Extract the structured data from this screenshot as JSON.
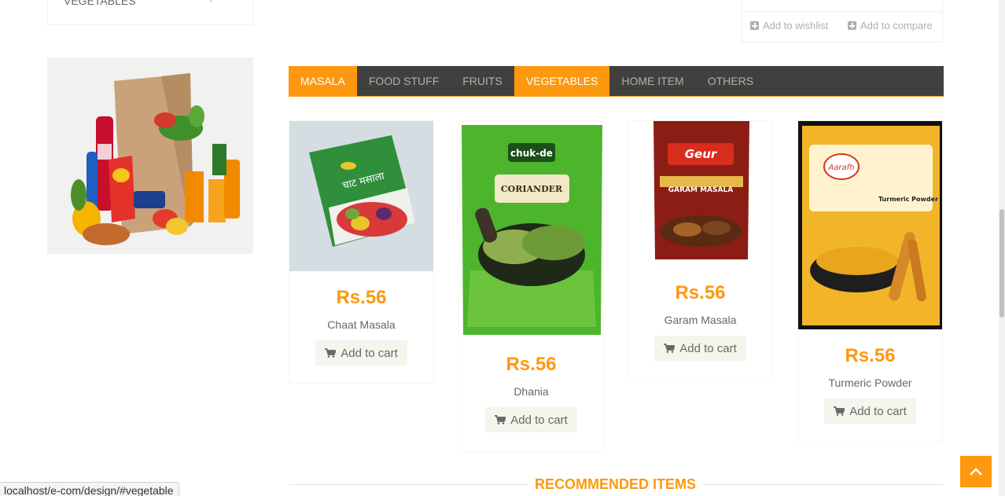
{
  "sidebar": {
    "category_partial": "VEGETABLES",
    "category_toggle": "+"
  },
  "top_widget": {
    "wishlist_label": "Add to wishlist",
    "compare_label": "Add to compare"
  },
  "tabs": [
    {
      "label": "MASALA",
      "active": true
    },
    {
      "label": "FOOD STUFF",
      "active": false
    },
    {
      "label": "FRUITS",
      "active": false
    },
    {
      "label": "VEGETABLES",
      "active": true
    },
    {
      "label": "HOME ITEM",
      "active": false
    },
    {
      "label": "OTHERS",
      "active": false
    }
  ],
  "products": [
    {
      "price": "Rs.56",
      "name": "Chaat Masala",
      "button": "Add to cart",
      "image_text": "चाट मसाला"
    },
    {
      "price": "Rs.56",
      "name": "Dhania",
      "button": "Add to cart",
      "image_text": "CORIANDER",
      "image_brand": "chuk-de"
    },
    {
      "price": "Rs.56",
      "name": "Garam Masala",
      "button": "Add to cart",
      "image_text": "GARAM MASALA",
      "image_brand": "Geur"
    },
    {
      "price": "Rs.56",
      "name": "Turmeric Powder",
      "button": "Add to cart",
      "image_text": "Turmeric Powder",
      "image_brand": "Aarafh"
    }
  ],
  "section": {
    "title": "RECOMMENDED ITEMS"
  },
  "status_bar": {
    "url": "localhost/e-com/design/#vegetable"
  },
  "colors": {
    "accent": "#fe980f",
    "tab_bg": "#40403e",
    "text": "#696763"
  },
  "icons": {
    "cart": "shopping-cart-icon",
    "scroll_up": "chevron-up-icon",
    "add": "plus-square-icon"
  }
}
